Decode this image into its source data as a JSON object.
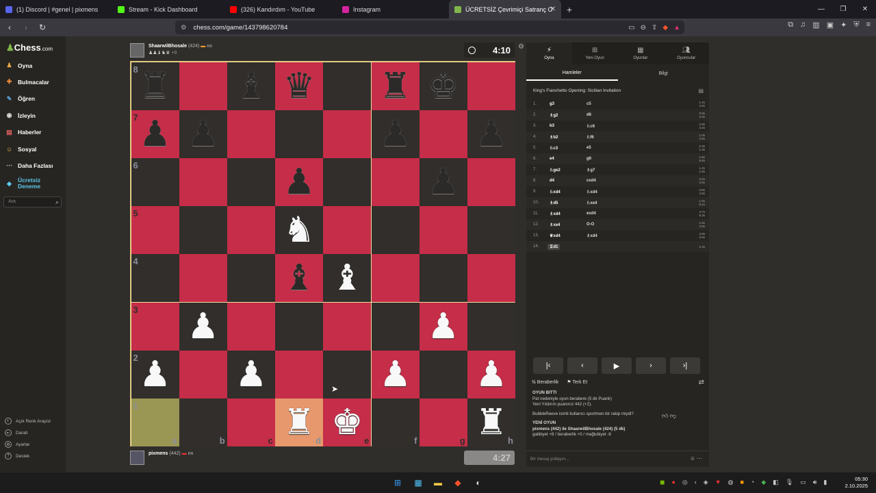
{
  "browser": {
    "tabs": [
      {
        "title": "(1) Discord | #genel | pixmens",
        "icon": "discord-icon",
        "color": "#5865f2",
        "active": false
      },
      {
        "title": "Stream - Kick Dashboard",
        "icon": "kick-icon",
        "color": "#53fc18",
        "active": false
      },
      {
        "title": "(326) Kandırdım - YouTube",
        "icon": "youtube-icon",
        "color": "#ff0000",
        "active": false
      },
      {
        "title": "Instagram",
        "icon": "instagram-icon",
        "color": "#d6249f",
        "active": false
      },
      {
        "title": "ÜCRETSİZ Çevrimiçi Satranç O",
        "icon": "chess-icon",
        "color": "#81b64c",
        "active": true
      }
    ],
    "url": "chess.com/game/143798620784"
  },
  "sidebar": {
    "logo_main": "Chess",
    "logo_suffix": ".com",
    "items": [
      {
        "label": "Oyna",
        "icon": "play-icon"
      },
      {
        "label": "Bulmacalar",
        "icon": "puzzle-icon"
      },
      {
        "label": "Öğren",
        "icon": "learn-icon"
      },
      {
        "label": "İzleyin",
        "icon": "watch-icon"
      },
      {
        "label": "Haberler",
        "icon": "news-icon"
      },
      {
        "label": "Sosyal",
        "icon": "social-icon"
      },
      {
        "label": "Daha Fazlası",
        "icon": "more-icon"
      }
    ],
    "trial_line1": "Ücretsiz",
    "trial_line2": "Deneme",
    "search_placeholder": "Ara",
    "footer": [
      {
        "label": "Açık Renk Arayüz",
        "icon": "theme-icon"
      },
      {
        "label": "Daralt",
        "icon": "collapse-icon"
      },
      {
        "label": "Ayarlar",
        "icon": "settings-icon"
      },
      {
        "label": "Destek",
        "icon": "help-icon"
      }
    ]
  },
  "opponent": {
    "name": "ShaarwilBhosale",
    "rating": "(424)",
    "captured": "♟♟♝♞♛",
    "advantage": "+9",
    "clock": "4:10"
  },
  "player": {
    "name": "pixmens",
    "rating": "(442)",
    "captured": "",
    "clock": "4:27"
  },
  "board": {
    "ranks": [
      "8",
      "7",
      "6",
      "5",
      "4",
      "3",
      "2",
      "1"
    ],
    "files": [
      "a",
      "b",
      "c",
      "d",
      "e",
      "f",
      "g",
      "h"
    ],
    "highlight_squares": [
      "a1"
    ],
    "highlight_dest": [
      "d1"
    ],
    "position": [
      [
        "r",
        "",
        "b",
        "q",
        "",
        "r",
        "k",
        ""
      ],
      [
        "p",
        "p",
        "",
        "",
        "",
        "p",
        "",
        "p"
      ],
      [
        "",
        "",
        "",
        "p",
        "",
        "",
        "p",
        ""
      ],
      [
        "",
        "",
        "",
        "N",
        "",
        "",
        "",
        ""
      ],
      [
        "",
        "",
        "",
        "b",
        "B",
        "",
        "",
        ""
      ],
      [
        "",
        "P",
        "",
        "",
        "",
        "",
        "P",
        ""
      ],
      [
        "P",
        "",
        "P",
        "",
        "",
        "P",
        "",
        "P"
      ],
      [
        "",
        "",
        "",
        "R",
        "K",
        "",
        "",
        "R"
      ]
    ]
  },
  "panel": {
    "tabs": [
      {
        "label": "Oyna",
        "icon": "bolt-icon"
      },
      {
        "label": "Yeni Oyun",
        "icon": "plus-icon"
      },
      {
        "label": "Oyunlar",
        "icon": "grid-icon"
      },
      {
        "label": "Oyuncular",
        "icon": "players-icon"
      }
    ],
    "subtabs": [
      "Hamleler",
      "Bilgi"
    ],
    "opening": "King's Fianchetto Opening: Sicilian Invitation",
    "moves": [
      {
        "n": "1.",
        "w": "g3",
        "b": "c5",
        "tw": "1.4s",
        "tb": "4.3s"
      },
      {
        "n": "2.",
        "w": "♗g2",
        "b": "d6",
        "tw": "0.8s",
        "tb": "2.3s"
      },
      {
        "n": "3.",
        "w": "b3",
        "b": "♘c6",
        "tw": "2.8s",
        "tb": "3.4s"
      },
      {
        "n": "4.",
        "w": "♗b2",
        "b": "♘f6",
        "tw": "1.0s",
        "tb": "2.6s"
      },
      {
        "n": "5.",
        "w": "♘c3",
        "b": "e5",
        "tw": "2.3s",
        "tb": "1.3s"
      },
      {
        "n": "6.",
        "w": "e4",
        "b": "g6",
        "tw": "1.8s",
        "tb": "5.6s"
      },
      {
        "n": "7.",
        "w": "♘ge2",
        "b": "♗g7",
        "tw": "1.2s",
        "tb": "1.8s"
      },
      {
        "n": "8.",
        "w": "d4",
        "b": "cxd4",
        "tw": "3.4s",
        "tb": "2.5s"
      },
      {
        "n": "9.",
        "w": "♘xd4",
        "b": "♘xd4",
        "tw": "3.8s",
        "tb": "4.9s"
      },
      {
        "n": "10.",
        "w": "♗d5",
        "b": "♘xe4",
        "tw": "1.6s",
        "tb": "9.1s"
      },
      {
        "n": "11.",
        "w": "♗xd4",
        "b": "exd4",
        "tw": "4.7s",
        "tb": "5.3s"
      },
      {
        "n": "12.",
        "w": "♗xe4",
        "b": "O-O",
        "tw": "1.5s",
        "tb": "2.8s"
      },
      {
        "n": "13.",
        "w": "♕xd4",
        "b": "♗xd4",
        "tw": "2.8s",
        "tb": "3.0s"
      },
      {
        "n": "14.",
        "w": "♖d1",
        "b": "",
        "tw": "2.4s",
        "tb": ""
      }
    ],
    "draw_label": "Beraberlik",
    "resign_label": "Terk Et",
    "chat": {
      "over_title": "OYUN BİTTİ",
      "over_line1": "Pat nedeniyle oyun berabere (5 dk Puanlı)",
      "over_line2": "Yeni Yıldırım puanınız 442 (+2).",
      "sportsman": "BubbleReeve isimli kullanıcı sportmen bir rakip miydi?",
      "new_title": "YENİ OYUN",
      "new_line1": "pixmens (442) ile ShaarwilBhosale (424) (5 dk)",
      "new_line2": "galibiyet +8 / beraberlik +0 / mağlubiyet -8"
    },
    "chat_placeholder": "Bir mesaj yollayın..."
  },
  "taskbar": {
    "time": "05:30",
    "date": "2.10.2025"
  }
}
